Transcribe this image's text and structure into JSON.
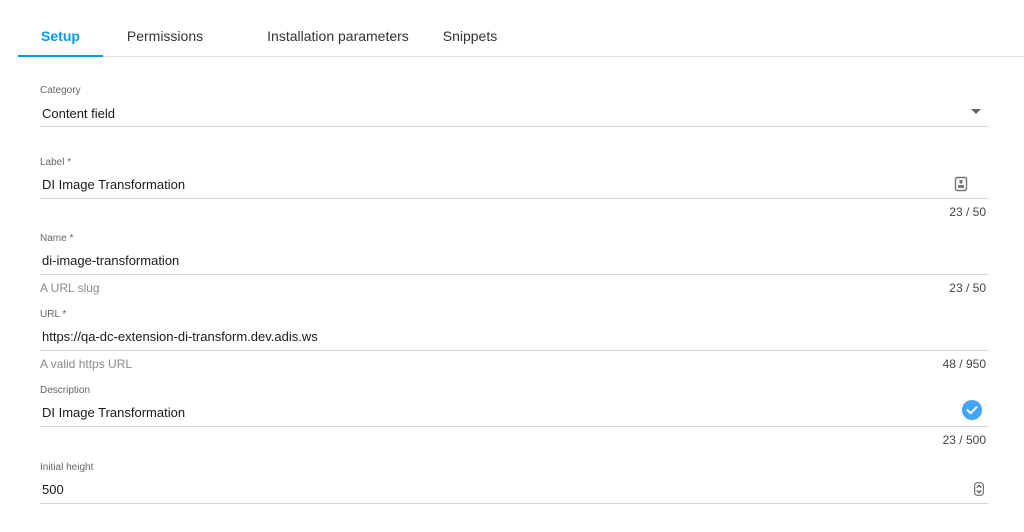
{
  "tabs": [
    {
      "label": "Setup",
      "active": true
    },
    {
      "label": "Permissions",
      "active": false
    },
    {
      "label": "Installation parameters",
      "active": false
    },
    {
      "label": "Snippets",
      "active": false
    }
  ],
  "fields": {
    "category": {
      "label": "Category",
      "value": "Content field",
      "icon": "dropdown-arrow-icon"
    },
    "label": {
      "label": "Label *",
      "value": "DI Image Transformation",
      "counter": "23 / 50",
      "icon": "contact-card-icon"
    },
    "name": {
      "label": "Name *",
      "value": "di-image-transformation",
      "helper": "A URL slug",
      "counter": "23 / 50"
    },
    "url": {
      "label": "URL *",
      "value": "https://qa-dc-extension-di-transform.dev.adis.ws",
      "helper": "A valid https URL",
      "counter": "48 / 950"
    },
    "description": {
      "label": "Description",
      "value": "DI Image Transformation",
      "counter": "23 / 500",
      "icon": "check-circle-icon"
    },
    "initial_height": {
      "label": "Initial height",
      "value": "500",
      "icon": "number-stepper-icon"
    }
  },
  "colors": {
    "accent": "#039be5",
    "check": "#42a5f5"
  }
}
